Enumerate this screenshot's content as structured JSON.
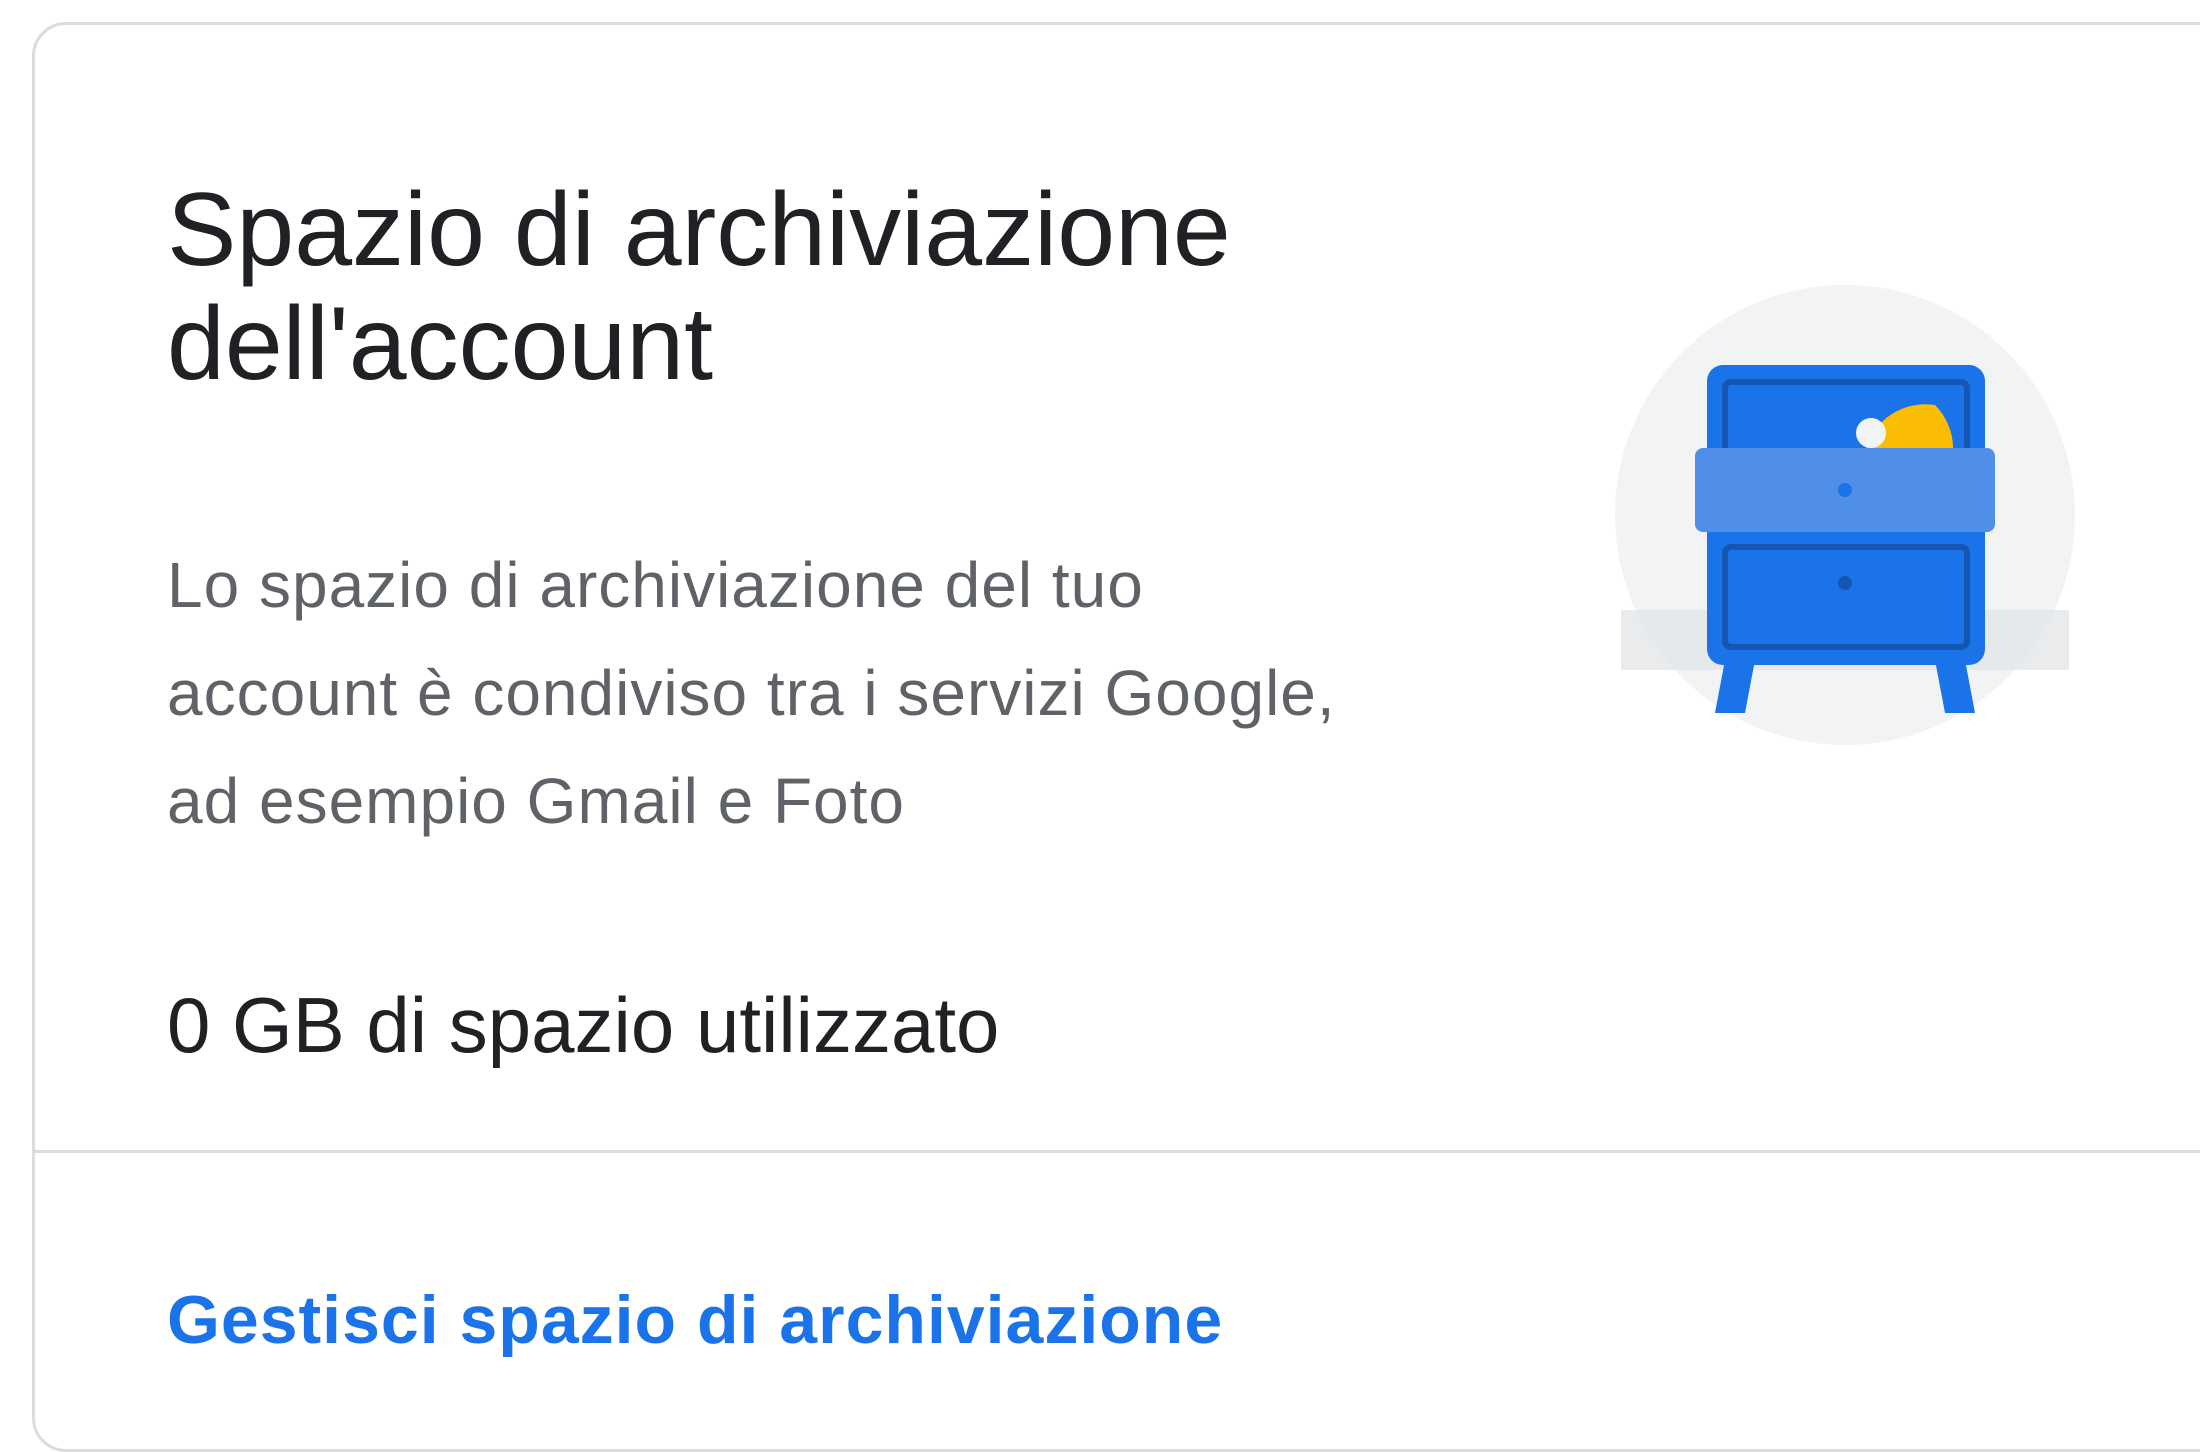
{
  "card": {
    "title": "Spazio di archiviazione dell'account",
    "description": "Lo spazio di archiviazione del tuo account è condiviso tra i servizi Google, ad esempio Gmail e Foto",
    "usage_text": "0 GB di spazio utilizzato",
    "manage_link_label": "Gestisci spazio di archiviazione",
    "illustration_icon": "drawer-cabinet-icon"
  },
  "colors": {
    "title_text": "#202124",
    "secondary_text": "#5f6368",
    "link": "#1a73e8",
    "border": "#dadce0",
    "cabinet_blue": "#1a73e8",
    "drawer_light_blue": "#4f8fe8",
    "accent_yellow": "#fbbc04",
    "accent_red": "#d93025"
  }
}
